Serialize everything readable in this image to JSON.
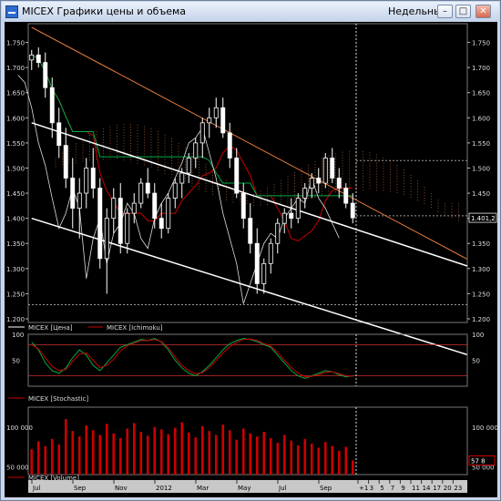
{
  "window": {
    "title": "MICEX Графики цены и объема",
    "period": "Недельный",
    "buttons": {
      "minimize": "–",
      "maximize": "□",
      "close": "✕"
    }
  },
  "colors": {
    "background": "#000000",
    "price_candle": "#ffffff",
    "ichimoku_tenkan": "#cc0000",
    "ichimoku_kijun": "#00aa44",
    "ichimoku_cloud": "#e07a3a",
    "channel": "#ffffff",
    "resistance_trend": "#e07a3a",
    "stoch_k": "#00aa44",
    "stoch_d": "#cc0000",
    "stoch_levels": "#cc3333",
    "volume_bars": "#cc0000",
    "grid": "#555555"
  },
  "price_panel": {
    "legend": [
      "MICEX [Цена]",
      "MICEX [Ichimoku]"
    ],
    "y_ticks": [
      "1.750",
      "1.700",
      "1.650",
      "1.600",
      "1.550",
      "1.500",
      "1.450",
      "1.400",
      "1.350",
      "1.300",
      "1.250",
      "1.200"
    ],
    "last_price_label": "1.401,2",
    "ylim": [
      1200,
      1780
    ]
  },
  "stoch_panel": {
    "legend": "MICEX [Stochastic]",
    "y_ticks": [
      "100",
      "50"
    ],
    "levels": [
      80,
      20
    ]
  },
  "volume_panel": {
    "legend": "MICEX [Volume]",
    "y_ticks": [
      "100 000",
      "50 000"
    ],
    "last_volume_label": "57 8"
  },
  "x_axis": {
    "labels": [
      "Jul",
      "Sep",
      "Nov",
      "2012",
      "Mar",
      "May",
      "Jul",
      "Sep",
      "+1",
      "3",
      "5",
      "7",
      "9",
      "11",
      "14",
      "17",
      "20",
      "23"
    ]
  },
  "chart_data": {
    "type": "candlestick",
    "title": "",
    "period": "weekly",
    "ylim": [
      1200,
      1780
    ],
    "ohlc": [
      [
        1715,
        1735,
        1695,
        1725
      ],
      [
        1725,
        1740,
        1700,
        1710
      ],
      [
        1710,
        1730,
        1640,
        1660
      ],
      [
        1660,
        1680,
        1560,
        1590
      ],
      [
        1590,
        1620,
        1520,
        1545
      ],
      [
        1545,
        1580,
        1460,
        1480
      ],
      [
        1480,
        1520,
        1380,
        1420
      ],
      [
        1420,
        1480,
        1360,
        1450
      ],
      [
        1450,
        1520,
        1420,
        1500
      ],
      [
        1500,
        1540,
        1440,
        1460
      ],
      [
        1460,
        1480,
        1300,
        1320
      ],
      [
        1320,
        1420,
        1250,
        1400
      ],
      [
        1400,
        1460,
        1370,
        1440
      ],
      [
        1440,
        1470,
        1330,
        1350
      ],
      [
        1350,
        1420,
        1330,
        1410
      ],
      [
        1410,
        1450,
        1390,
        1430
      ],
      [
        1430,
        1480,
        1420,
        1470
      ],
      [
        1470,
        1500,
        1440,
        1450
      ],
      [
        1450,
        1470,
        1380,
        1400
      ],
      [
        1400,
        1430,
        1360,
        1380
      ],
      [
        1380,
        1450,
        1370,
        1440
      ],
      [
        1440,
        1480,
        1420,
        1470
      ],
      [
        1470,
        1500,
        1440,
        1490
      ],
      [
        1490,
        1530,
        1470,
        1520
      ],
      [
        1520,
        1560,
        1500,
        1550
      ],
      [
        1550,
        1600,
        1520,
        1590
      ],
      [
        1590,
        1620,
        1560,
        1600
      ],
      [
        1600,
        1640,
        1580,
        1620
      ],
      [
        1620,
        1640,
        1560,
        1570
      ],
      [
        1570,
        1590,
        1500,
        1520
      ],
      [
        1520,
        1540,
        1440,
        1450
      ],
      [
        1450,
        1470,
        1380,
        1400
      ],
      [
        1400,
        1430,
        1330,
        1350
      ],
      [
        1350,
        1380,
        1250,
        1270
      ],
      [
        1270,
        1320,
        1250,
        1310
      ],
      [
        1310,
        1360,
        1290,
        1350
      ],
      [
        1350,
        1400,
        1330,
        1390
      ],
      [
        1390,
        1420,
        1370,
        1410
      ],
      [
        1410,
        1440,
        1380,
        1400
      ],
      [
        1400,
        1450,
        1390,
        1440
      ],
      [
        1440,
        1470,
        1420,
        1460
      ],
      [
        1460,
        1490,
        1440,
        1480
      ],
      [
        1480,
        1500,
        1450,
        1470
      ],
      [
        1470,
        1530,
        1460,
        1520
      ],
      [
        1520,
        1540,
        1470,
        1480
      ],
      [
        1480,
        1500,
        1440,
        1460
      ],
      [
        1460,
        1470,
        1420,
        1430
      ],
      [
        1430,
        1450,
        1390,
        1401
      ]
    ],
    "volume": [
      72000,
      82000,
      76000,
      85000,
      78000,
      110000,
      95000,
      88000,
      102000,
      96000,
      90000,
      104000,
      92000,
      86000,
      98000,
      105000,
      94000,
      89000,
      100000,
      97000,
      91000,
      99000,
      106000,
      93000,
      87000,
      101000,
      95000,
      90000,
      103000,
      96000,
      84000,
      98000,
      92000,
      88000,
      94000,
      86000,
      80000,
      90000,
      83000,
      77000,
      85000,
      79000,
      74000,
      81000,
      76000,
      70000,
      75000,
      57800
    ],
    "stoch_k": [
      85,
      70,
      45,
      30,
      25,
      35,
      55,
      70,
      60,
      40,
      30,
      45,
      60,
      75,
      80,
      85,
      90,
      88,
      92,
      85,
      70,
      50,
      35,
      25,
      20,
      28,
      40,
      55,
      70,
      82,
      88,
      92,
      90,
      86,
      80,
      75,
      60,
      45,
      30,
      20,
      15,
      20,
      25,
      30,
      28,
      22,
      18,
      20
    ],
    "stoch_d": [
      80,
      72,
      55,
      38,
      30,
      32,
      48,
      62,
      64,
      50,
      36,
      40,
      52,
      68,
      78,
      83,
      88,
      88,
      90,
      86,
      74,
      56,
      40,
      30,
      24,
      26,
      36,
      50,
      64,
      76,
      85,
      90,
      91,
      88,
      82,
      77,
      65,
      50,
      36,
      25,
      18,
      19,
      22,
      27,
      28,
      24,
      20,
      19
    ],
    "channel_upper": [
      [
        0,
        1590
      ],
      [
        47,
        1380
      ]
    ],
    "channel_lower": [
      [
        0,
        1400
      ],
      [
        47,
        1200
      ]
    ],
    "resistance_line": [
      [
        0,
        1780
      ],
      [
        47,
        1440
      ]
    ]
  }
}
